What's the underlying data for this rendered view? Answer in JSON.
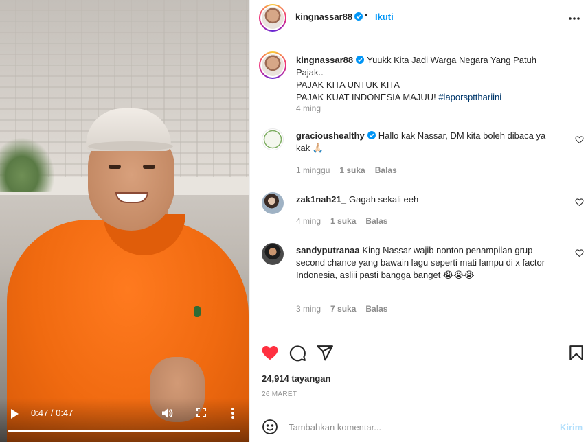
{
  "video": {
    "time": "0:47 / 0:47",
    "progress": 1.0
  },
  "header": {
    "username": "kingnassar88",
    "dot": "•",
    "follow_label": "Ikuti"
  },
  "caption": {
    "username": "kingnassar88",
    "line1": "Yuukk Kita Jadi Warga Negara Yang Patuh Pajak..",
    "line2": "PAJAK KITA UNTUK KITA",
    "line3_text": "PAJAK KUAT INDONESIA MAJUU! ",
    "hashtag": "#laporsptthariini",
    "time": "4 ming"
  },
  "comments": [
    {
      "username": "gracioushealthy",
      "text": "Hallo kak Nassar, DM kita boleh dibaca ya kak 🙏🏻",
      "time": "1 minggu",
      "likes": "1 suka",
      "reply": "Balas"
    },
    {
      "username": "zak1nah21_",
      "text": "Gagah sekali eeh",
      "time": "4 ming",
      "likes": "1 suka",
      "reply": "Balas"
    },
    {
      "username": "sandyputranaa",
      "text": "King Nassar wajib nonton penampilan grup second chance yang bawain lagu seperti mati lampu di x factor Indonesia, asliii pasti bangga banget 😭😭😭",
      "time": "3 ming",
      "likes": "7 suka",
      "reply": "Balas"
    }
  ],
  "stats": {
    "views": "24,914 tayangan",
    "date": "26 MARET"
  },
  "comment_box": {
    "placeholder": "Tambahkan komentar...",
    "post_label": "Kirim"
  },
  "colors": {
    "accent": "#0095f6",
    "like_active": "#ff3040",
    "hashtag": "#00376b",
    "muted": "#8e8e8e"
  }
}
